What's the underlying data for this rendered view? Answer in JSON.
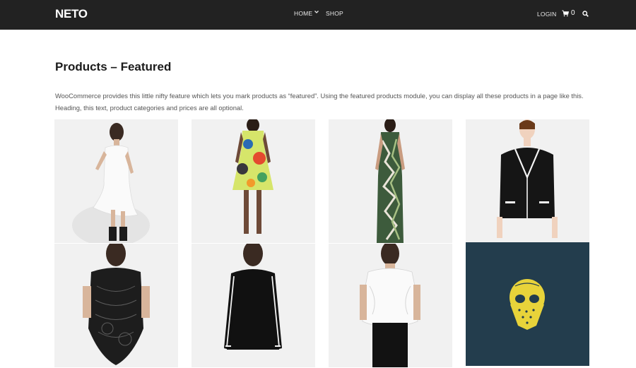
{
  "header": {
    "logo": "NETO",
    "nav": [
      {
        "label": "HOME",
        "has_dropdown": true
      },
      {
        "label": "SHOP",
        "has_dropdown": false
      }
    ],
    "login_label": "LOGIN",
    "cart_count": "0",
    "icons": [
      "shopping-cart-icon",
      "search-icon",
      "chevron-down-icon"
    ]
  },
  "main": {
    "title": "Products – Featured",
    "intro_line1": "WooCommerce provides this little nifty feature which lets you mark products as “featured”. Using the featured products module, you can display all these products in a page like this.",
    "intro_line2": "Heading, this text, product categories and prices are all optional."
  },
  "colors": {
    "header_bg": "#222222",
    "product_bg": "#f1f1f1",
    "poster_bg": "#233d4d",
    "poster_accent": "#e8d33a"
  }
}
